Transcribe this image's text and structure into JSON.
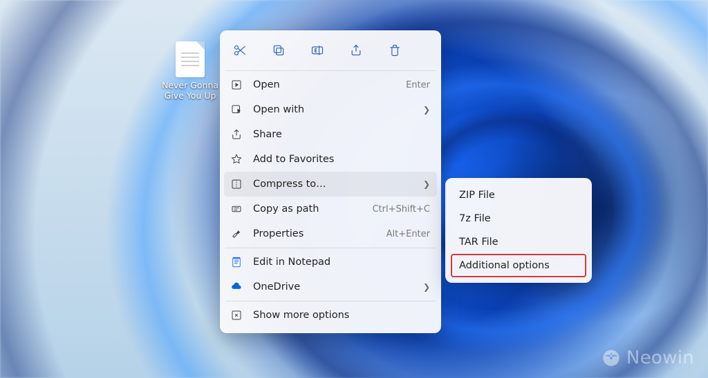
{
  "desktop": {
    "file_label": "Never Gonna\nGive You Up"
  },
  "context_menu": {
    "quick_actions": {
      "cut": "cut",
      "copy": "copy",
      "rename": "rename",
      "share": "share",
      "delete": "delete"
    },
    "items": {
      "open": {
        "label": "Open",
        "accel": "Enter"
      },
      "open_with": {
        "label": "Open with"
      },
      "share": {
        "label": "Share"
      },
      "favorites": {
        "label": "Add to Favorites"
      },
      "compress": {
        "label": "Compress to…"
      },
      "copy_path": {
        "label": "Copy as path",
        "accel": "Ctrl+Shift+C"
      },
      "properties": {
        "label": "Properties",
        "accel": "Alt+Enter"
      },
      "edit_notepad": {
        "label": "Edit in Notepad"
      },
      "onedrive": {
        "label": "OneDrive"
      },
      "show_more": {
        "label": "Show more options"
      }
    }
  },
  "submenu": {
    "zip": "ZIP File",
    "sevenz": "7z File",
    "tar": "TAR File",
    "additional": "Additional options"
  },
  "watermark": {
    "text": "Neowin"
  }
}
